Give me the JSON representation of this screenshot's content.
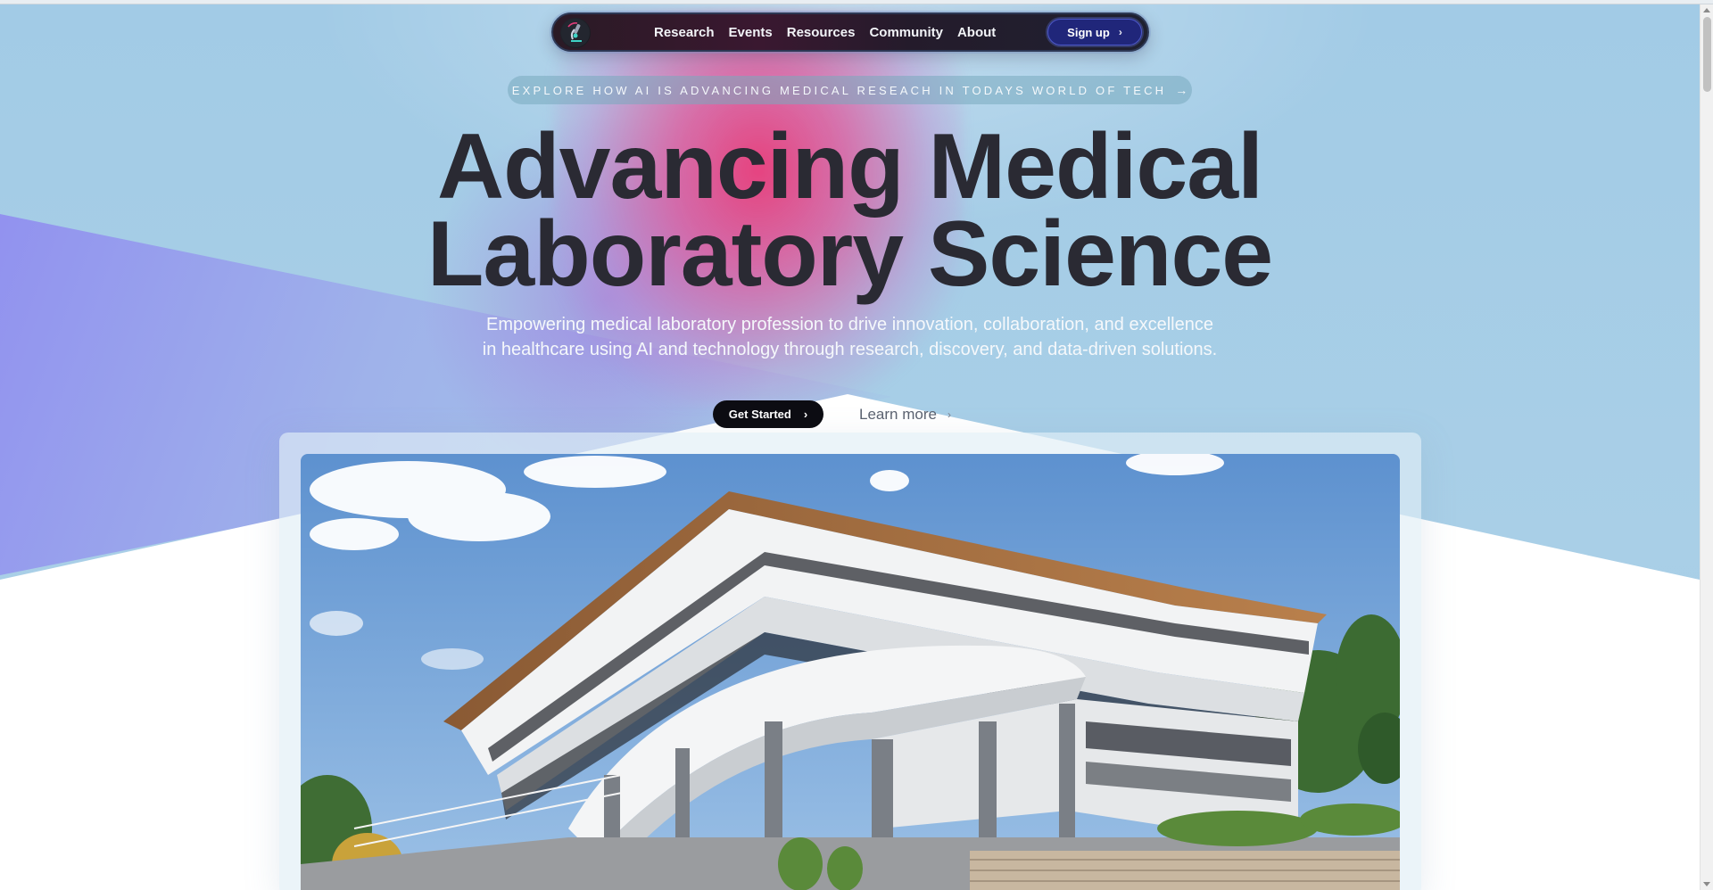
{
  "nav": {
    "links": [
      "Research",
      "Events",
      "Resources",
      "Community",
      "About"
    ],
    "signup_label": "Sign up",
    "logo_icon": "microscope-icon"
  },
  "announcement": {
    "text": "EXPLORE HOW AI IS ADVANCING MEDICAL RESEACH IN TODAYS WORLD OF TECH",
    "icon": "arrow-right-icon"
  },
  "hero": {
    "title_line1": "Advancing Medical",
    "title_line2": "Laboratory Science",
    "subtitle_line1": "Empowering medical laboratory profession to drive innovation, collaboration, and excellence",
    "subtitle_line2": "in healthcare using AI and technology through research, discovery, and data-driven solutions.",
    "primary_cta": "Get Started",
    "secondary_cta": "Learn more"
  },
  "colors": {
    "hero_sky": "#a6cde6",
    "accent_pink": "#e93a78",
    "accent_violet": "#8f8cf0",
    "nav_bg": "#241b2b",
    "signup_bg": "#20267a",
    "headline": "#2a2a33",
    "cta_bg": "#0c0c12"
  },
  "images": {
    "hero_photo": "modern white multi-storey building with balconies and columns under blue sky"
  }
}
